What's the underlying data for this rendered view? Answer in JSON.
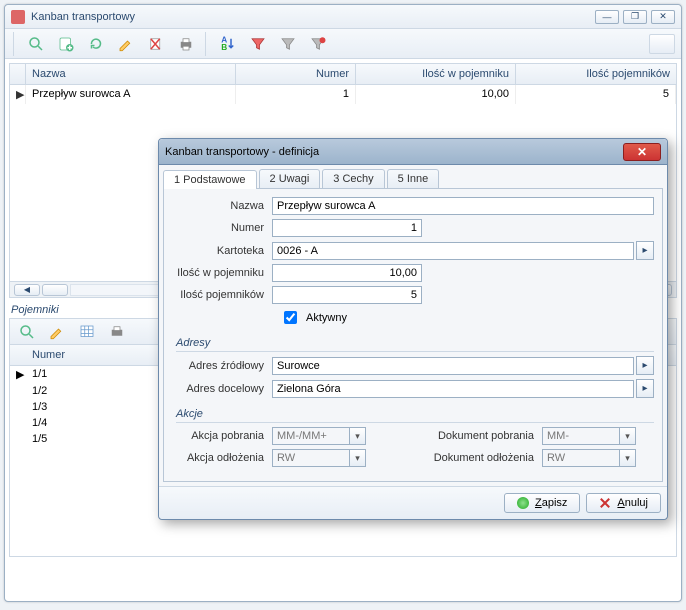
{
  "window": {
    "title": "Kanban transportowy",
    "win_buttons": {
      "min": "—",
      "max": "❐",
      "close": "✕"
    }
  },
  "toolbar_icons": [
    "search-icon",
    "add-icon",
    "refresh-icon",
    "edit-icon",
    "delete-icon",
    "print-icon",
    "sort-icon",
    "filter-icon",
    "filter2-icon",
    "filter3-icon"
  ],
  "grid": {
    "columns": [
      "Nazwa",
      "Numer",
      "Ilość w pojemniku",
      "Ilość pojemników"
    ],
    "rows": [
      {
        "nazwa": "Przepływ surowca A",
        "numer": "1",
        "ilosc_w_pojemniku": "10,00",
        "ilosc_pojemnikow": "5"
      }
    ]
  },
  "pojemniki": {
    "title": "Pojemniki",
    "column": "Numer",
    "rows": [
      "1/1",
      "1/2",
      "1/3",
      "1/4",
      "1/5"
    ]
  },
  "dialog": {
    "title": "Kanban transportowy - definicja",
    "tabs": [
      "1 Podstawowe",
      "2 Uwagi",
      "3 Cechy",
      "5 Inne"
    ],
    "labels": {
      "nazwa": "Nazwa",
      "numer": "Numer",
      "kartoteka": "Kartoteka",
      "ilosc_w_pojemniku": "Ilość w pojemniku",
      "ilosc_pojemnikow": "Ilość pojemników",
      "aktywny": "Aktywny",
      "adresy": "Adresy",
      "adres_zrodlowy": "Adres źródłowy",
      "adres_docelowy": "Adres docelowy",
      "akcje": "Akcje",
      "akcja_pobrania": "Akcja pobrania",
      "akcja_odlozenia": "Akcja odłożenia",
      "dokument_pobrania": "Dokument pobrania",
      "dokument_odlozenia": "Dokument odłożenia"
    },
    "values": {
      "nazwa": "Przepływ surowca A",
      "numer": "1",
      "kartoteka": "0026 - A",
      "ilosc_w_pojemniku": "10,00",
      "ilosc_pojemnikow": "5",
      "aktywny": true,
      "adres_zrodlowy": "Surowce",
      "adres_docelowy": "Zielona Góra",
      "akcja_pobrania": "MM-/MM+",
      "akcja_odlozenia": "RW",
      "dokument_pobrania": "MM-",
      "dokument_odlozenia": "RW"
    },
    "buttons": {
      "save": "Zapisz",
      "cancel": "Anuluj"
    }
  }
}
